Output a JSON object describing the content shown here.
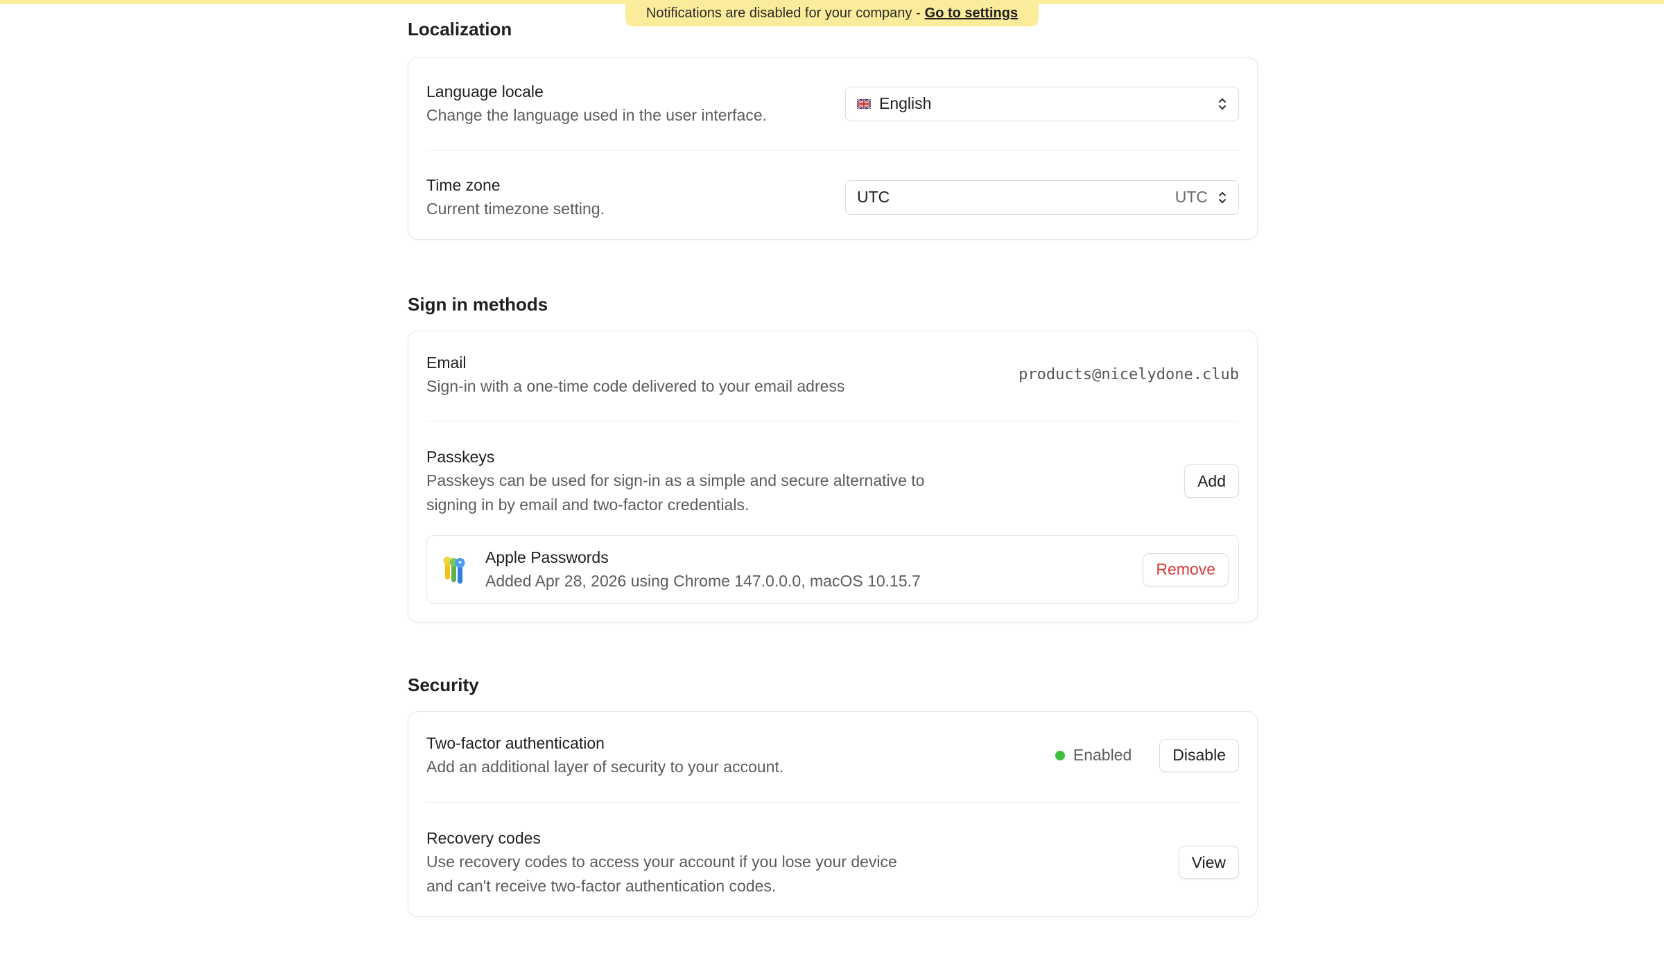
{
  "banner": {
    "text": "Notifications are disabled for your company -",
    "link": "Go to settings"
  },
  "localization": {
    "title": "Localization",
    "language": {
      "title": "Language locale",
      "desc": "Change the language used in the user interface.",
      "value": "English",
      "flag_icon": "uk-flag-icon"
    },
    "timezone": {
      "title": "Time zone",
      "desc": "Current timezone setting.",
      "value": "UTC",
      "suffix": "UTC"
    }
  },
  "sign_in": {
    "title": "Sign in methods",
    "email": {
      "title": "Email",
      "desc": "Sign-in with a one-time code delivered to your email adress",
      "value": "products@nicelydone.club"
    },
    "passkeys": {
      "title": "Passkeys",
      "desc_line1": "Passkeys can be used for sign-in as a simple and secure alternative to",
      "desc_line2": "signing in by email and two-factor credentials.",
      "add_label": "Add",
      "items": [
        {
          "name": "Apple Passwords",
          "detail": "Added Apr 28, 2026 using Chrome 147.0.0.0, macOS 10.15.7",
          "remove_label": "Remove",
          "icon": "apple-passwords-keys-icon"
        }
      ]
    }
  },
  "security": {
    "title": "Security",
    "two_factor": {
      "title": "Two-factor authentication",
      "desc": "Add an additional layer of security to your account.",
      "status": "Enabled",
      "status_color": "#3fbf3f",
      "disable_label": "Disable"
    },
    "recovery": {
      "title": "Recovery codes",
      "desc_line1": "Use recovery codes to access your account if you lose your device",
      "desc_line2": "and can't receive two-factor authentication codes.",
      "view_label": "View"
    }
  },
  "colors": {
    "banner_bg": "#fbec9b",
    "danger": "#d63b3b",
    "success": "#3fbf3f"
  }
}
